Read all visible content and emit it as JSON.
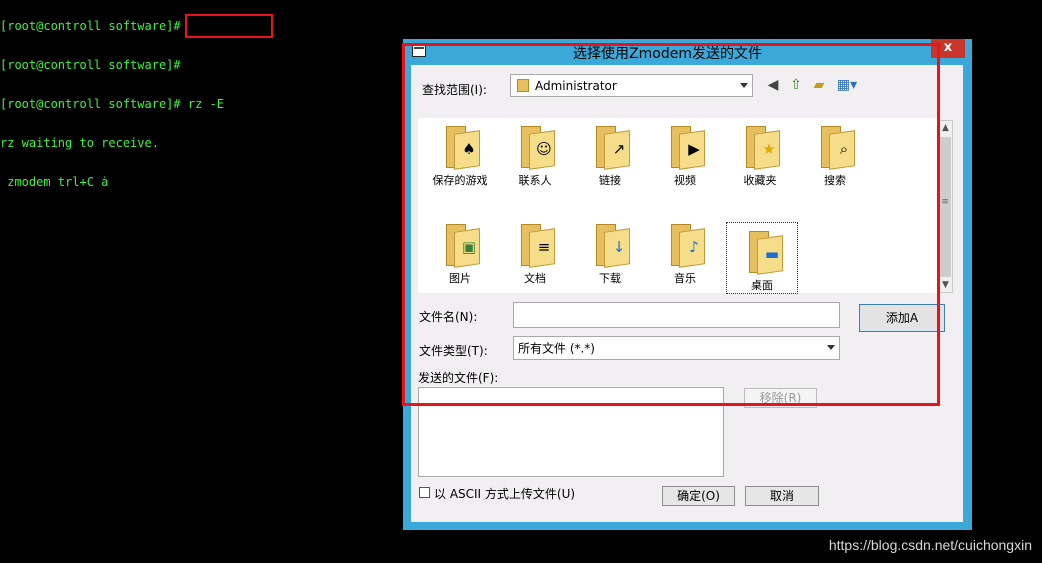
{
  "terminal": {
    "lines": [
      "[root@controll software]#",
      "[root@controll software]#",
      "[root@controll software]# rz -E",
      "rz waiting to receive.",
      " zmodem trl+C ȧ"
    ]
  },
  "dialog": {
    "title": "选择使用Zmodem发送的文件",
    "close_label": "x",
    "look_in_label": "查找范围(I):",
    "look_in_value": "Administrator",
    "toolbar": [
      "back-icon",
      "up-folder-icon",
      "new-folder-icon",
      "view-menu-icon"
    ],
    "items": [
      {
        "name": "保存的游戏",
        "emblem": "♠"
      },
      {
        "name": "联系人",
        "emblem": "☺"
      },
      {
        "name": "链接",
        "emblem": "↗"
      },
      {
        "name": "视频",
        "emblem": "▶"
      },
      {
        "name": "收藏夹",
        "emblem": "★"
      },
      {
        "name": "搜索",
        "emblem": "⌕"
      },
      {
        "name": "图片",
        "emblem": "▣"
      },
      {
        "name": "文档",
        "emblem": "≡"
      },
      {
        "name": "下载",
        "emblem": "↓"
      },
      {
        "name": "音乐",
        "emblem": "♪"
      },
      {
        "name": "桌面",
        "emblem": "▬"
      }
    ],
    "filename_label": "文件名(N):",
    "filename_value": "",
    "add_button": "添加A",
    "filetype_label": "文件类型(T):",
    "filetype_value": "所有文件 (*.*)",
    "send_files_label": "发送的文件(F):",
    "remove_button": "移除(R)",
    "ascii_label": "以 ASCII 方式上传文件(U)",
    "ok_button": "确定(O)",
    "cancel_button": "取消"
  },
  "watermark": "https://blog.csdn.net/cuichongxin",
  "colors": {
    "terminal_text": "#3ef23e",
    "dialog_frame": "#3aa9d9",
    "highlight": "#e8141c"
  }
}
